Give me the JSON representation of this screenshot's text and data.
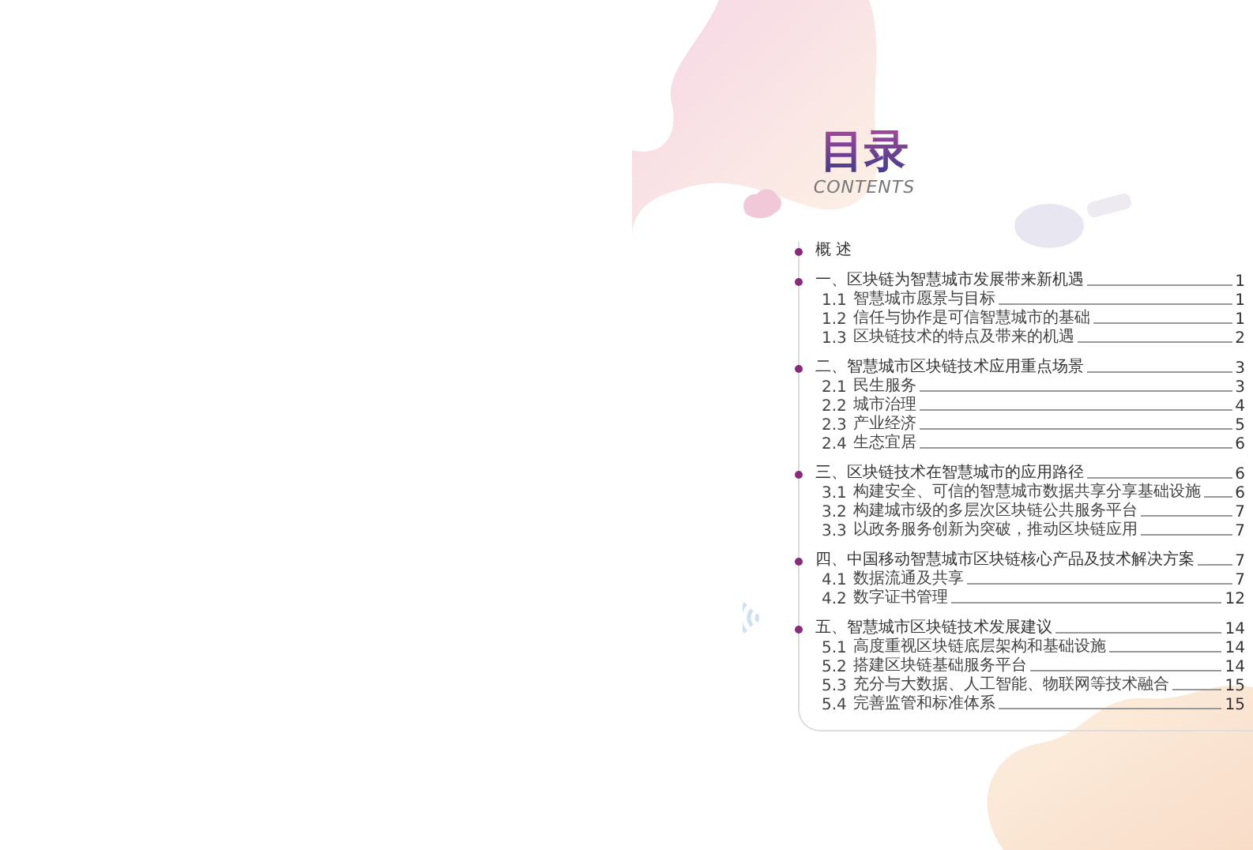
{
  "title": {
    "heading": "目录",
    "subtitle": "CONTENTS"
  },
  "toc": [
    {
      "title": "概 述"
    },
    {
      "title": "一、区块链为智慧城市发展带来新机遇",
      "page": "1",
      "children": [
        {
          "number": "1.1",
          "title": "智慧城市愿景与目标",
          "page": "1"
        },
        {
          "number": "1.2",
          "title": "信任与协作是可信智慧城市的基础",
          "page": "1"
        },
        {
          "number": "1.3",
          "title": "区块链技术的特点及带来的机遇",
          "page": "2"
        }
      ]
    },
    {
      "title": "二、智慧城市区块链技术应用重点场景",
      "page": "3",
      "children": [
        {
          "number": "2.1",
          "title": "民生服务",
          "page": "3"
        },
        {
          "number": "2.2",
          "title": "城市治理",
          "page": "4"
        },
        {
          "number": "2.3",
          "title": "产业经济",
          "page": "5"
        },
        {
          "number": "2.4",
          "title": "生态宜居",
          "page": "6"
        }
      ]
    },
    {
      "title": "三、区块链技术在智慧城市的应用路径",
      "page": "6",
      "children": [
        {
          "number": "3.1",
          "title": "构建安全、可信的智慧城市数据共享分享基础设施",
          "page": "6"
        },
        {
          "number": "3.2",
          "title": "构建城市级的多层次区块链公共服务平台",
          "page": "7"
        },
        {
          "number": "3.3",
          "title": "以政务服务创新为突破，推动区块链应用",
          "page": "7"
        }
      ]
    },
    {
      "title": "四、中国移动智慧城市区块链核心产品及技术解决方案",
      "page": "7",
      "children": [
        {
          "number": "4.1",
          "title": "数据流通及共享",
          "page": "7"
        },
        {
          "number": "4.2",
          "title": "数字证书管理",
          "page": "12"
        }
      ]
    },
    {
      "title": "五、智慧城市区块链技术发展建议",
      "page": "14",
      "children": [
        {
          "number": "5.1",
          "title": "高度重视区块链底层架构和基础设施",
          "page": "14"
        },
        {
          "number": "5.2",
          "title": "搭建区块链基础服务平台",
          "page": "14"
        },
        {
          "number": "5.3",
          "title": "充分与大数据、人工智能、物联网等技术融合",
          "page": "15"
        },
        {
          "number": "5.4",
          "title": "完善监管和标准体系",
          "page": "15"
        }
      ]
    }
  ]
}
